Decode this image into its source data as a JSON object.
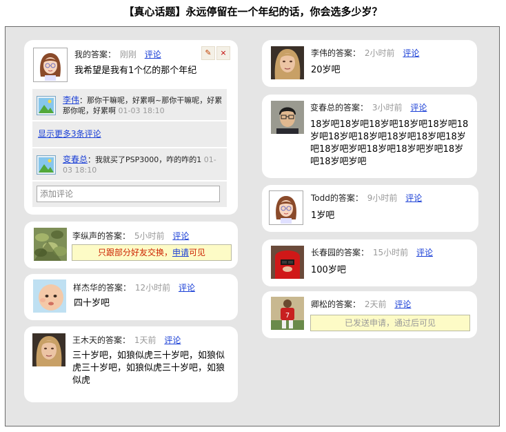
{
  "title": "【真心话题】永远停留在一个年纪的话，你会选多少岁？",
  "answer_suffix": "的答案：",
  "comment_link": "评论",
  "colors": {
    "link": "#1a3fd6",
    "notice_bg": "#fdfbc6",
    "notice_red": "#cc2200",
    "frame_bg": "#e5e5e5"
  },
  "left": [
    {
      "name": "我",
      "time": "刚刚",
      "avatar_icon": "cartoon-girl-avatar-icon",
      "answer": "我希望是我有1个亿的那个年纪",
      "tools": {
        "edit_icon": "✎",
        "delete_icon": "×"
      },
      "comments": [
        {
          "user": "李伟",
          "text": "：那你干嘛呢，好累啊~那你干嘛呢，好累那你呢，好累啊",
          "time": "01-03 18:10"
        },
        {
          "user": "变春总",
          "text": "：我就买了PSP3000，咋的咋的1",
          "time": "01-03 18:10"
        }
      ],
      "more_comments": "显示更多3条评论",
      "comment_placeholder": "添加评论"
    },
    {
      "name": "李纵声",
      "time": "5小时前",
      "avatar_icon": "plant-photo-avatar-icon",
      "notice": {
        "part1": "只跟部分好友交换，",
        "link": "申请",
        "part2": "可见"
      }
    },
    {
      "name": "样杰华",
      "time": "12小时前",
      "avatar_icon": "baby-photo-avatar-icon",
      "answer": "四十岁吧"
    },
    {
      "name": "王木天",
      "time": "1天前",
      "avatar_icon": "woman-photo-avatar-icon",
      "answer": "三十岁吧，如狼似虎三十岁吧，如狼似虎三十岁吧，如狼似虎三十岁吧，如狼似虎"
    }
  ],
  "right": [
    {
      "name": "李伟",
      "time": "2小时前",
      "avatar_icon": "woman-photo-avatar-icon",
      "answer": "20岁吧"
    },
    {
      "name": "变春总",
      "time": "3小时前",
      "avatar_icon": "man-glasses-photo-avatar-icon",
      "answer": "18岁吧18岁吧18岁吧18岁吧18岁吧18岁吧18岁吧18岁吧18岁吧18岁吧18岁吧18岁吧岁吧18岁吧18岁吧岁吧18岁吧18岁吧岁吧"
    },
    {
      "name": "Todd",
      "time": "9小时前",
      "avatar_icon": "cartoon-girl-avatar-icon",
      "answer": "1岁吧"
    },
    {
      "name": "长春园",
      "time": "15小时前",
      "avatar_icon": "red-hat-photo-avatar-icon",
      "answer": "100岁吧"
    },
    {
      "name": "卿松",
      "time": "2天前",
      "avatar_icon": "football-player-avatar-icon",
      "notice": "已发送申请，通过后可见"
    }
  ]
}
